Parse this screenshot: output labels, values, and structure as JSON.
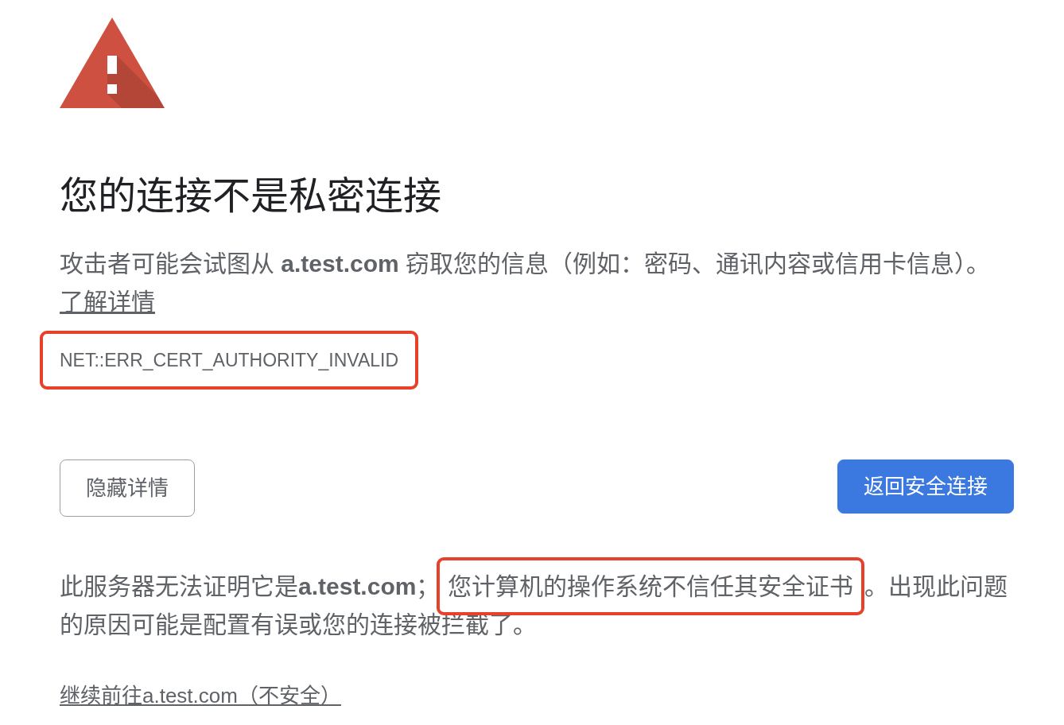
{
  "heading": "您的连接不是私密连接",
  "description": "攻击者可能会试图从 **a.test.com** 窃取您的信息（例如：密码、通讯内容或信用卡信息）。",
  "learn_more_link": "了解详情",
  "error_code": {
    "text": "NET::ERR_CERT_AUTHORITY_INVALID",
    "highlighted": true
  },
  "buttons": [
    {
      "label": "隐藏详情",
      "kind": "secondary"
    },
    {
      "label": "返回安全连接",
      "kind": "primary"
    }
  ],
  "details": {
    "parts": [
      {
        "text": "此服务器无法证明它是**a.test.com**；",
        "highlighted": false
      },
      {
        "text": "您计算机的操作系统不信任其安全证书",
        "highlighted": true
      },
      {
        "text": "。出现此问题的原因可能是配置有误或您的连接被拦截了。",
        "highlighted": false
      }
    ]
  },
  "proceed_link": "继续前往a.test.com（不安全）"
}
